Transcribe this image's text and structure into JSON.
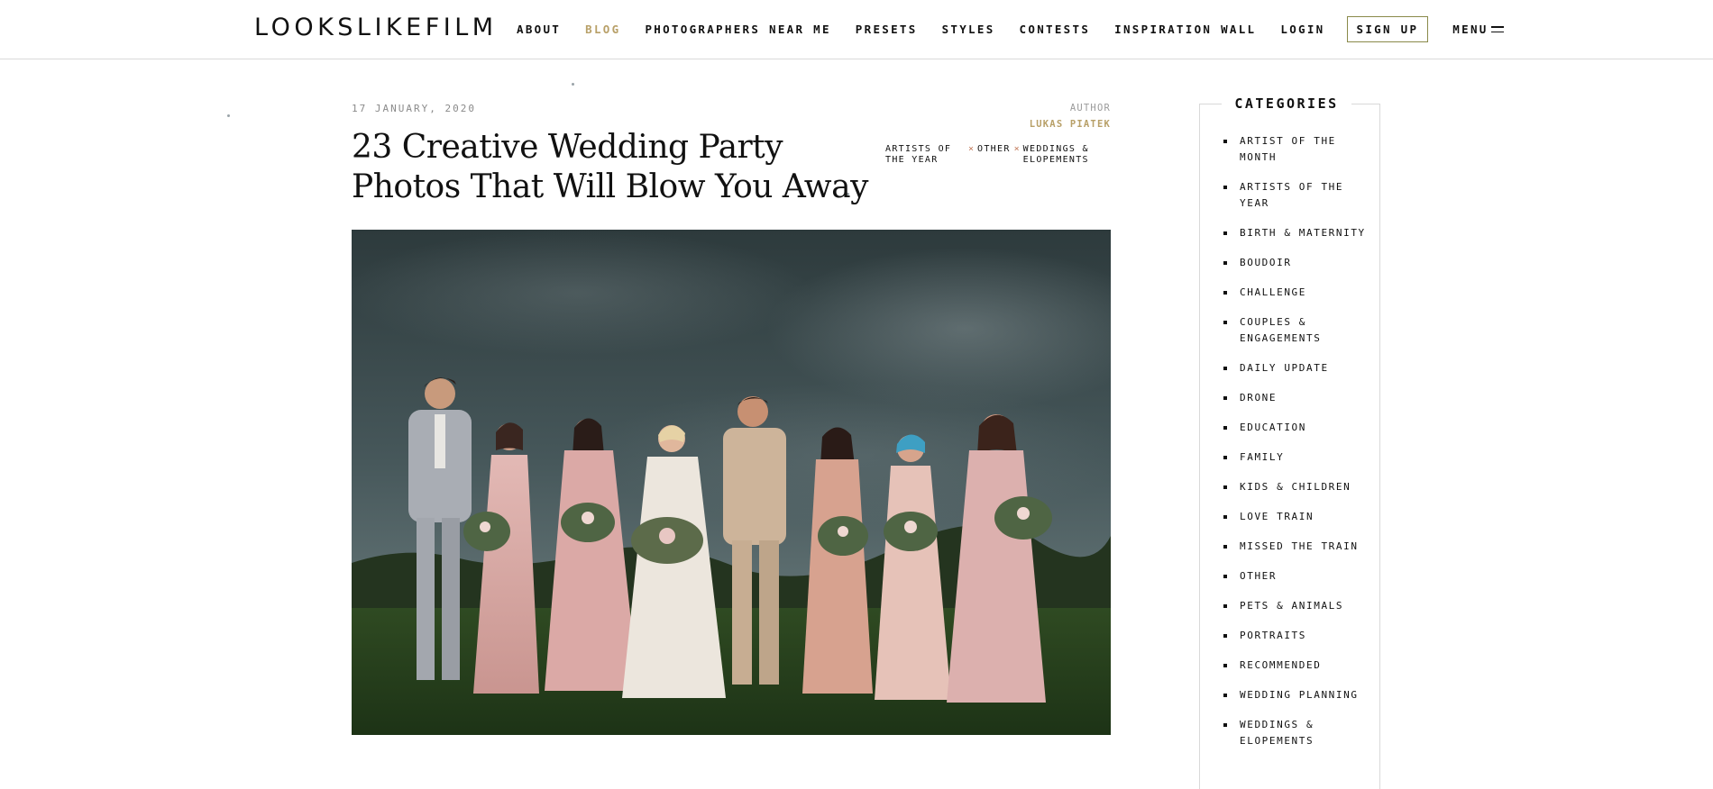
{
  "header": {
    "logo": "LOOKSLIKEFILM",
    "nav": [
      "ABOUT",
      "BLOG",
      "PHOTOGRAPHERS NEAR ME",
      "PRESETS",
      "STYLES",
      "CONTESTS",
      "INSPIRATION WALL",
      "LOGIN"
    ],
    "active_nav": "BLOG",
    "signup_label": "SIGN UP",
    "menu_label": "MENU",
    "menu_icon": "hamburger-icon"
  },
  "article": {
    "date": "17 JANUARY, 2020",
    "author_label": "AUTHOR",
    "author_name": "LUKAS PIATEK",
    "title": "23 Creative Wedding Party Photos That Will Blow You Away",
    "tags": [
      "ARTISTS OF THE YEAR",
      "OTHER",
      "WEDDINGS & ELOPEMENTS"
    ],
    "tag_separator": "×",
    "hero_image": "wedding-party-photo"
  },
  "sidebar": {
    "title": "CATEGORIES",
    "categories": [
      "ARTIST OF THE MONTH",
      "ARTISTS OF THE YEAR",
      "BIRTH & MATERNITY",
      "BOUDOIR",
      "CHALLENGE",
      "COUPLES & ENGAGEMENTS",
      "DAILY UPDATE",
      "DRONE",
      "EDUCATION",
      "FAMILY",
      "KIDS & CHILDREN",
      "LOVE TRAIN",
      "MISSED THE TRAIN",
      "OTHER",
      "PETS & ANIMALS",
      "PORTRAITS",
      "RECOMMENDED",
      "WEDDING PLANNING",
      "WEDDINGS & ELOPEMENTS"
    ]
  },
  "colors": {
    "accent": "#b8a068",
    "tag_separator": "#c27a5a",
    "text": "#111111",
    "muted": "#8a8a8a",
    "border": "#d9d9d9"
  }
}
